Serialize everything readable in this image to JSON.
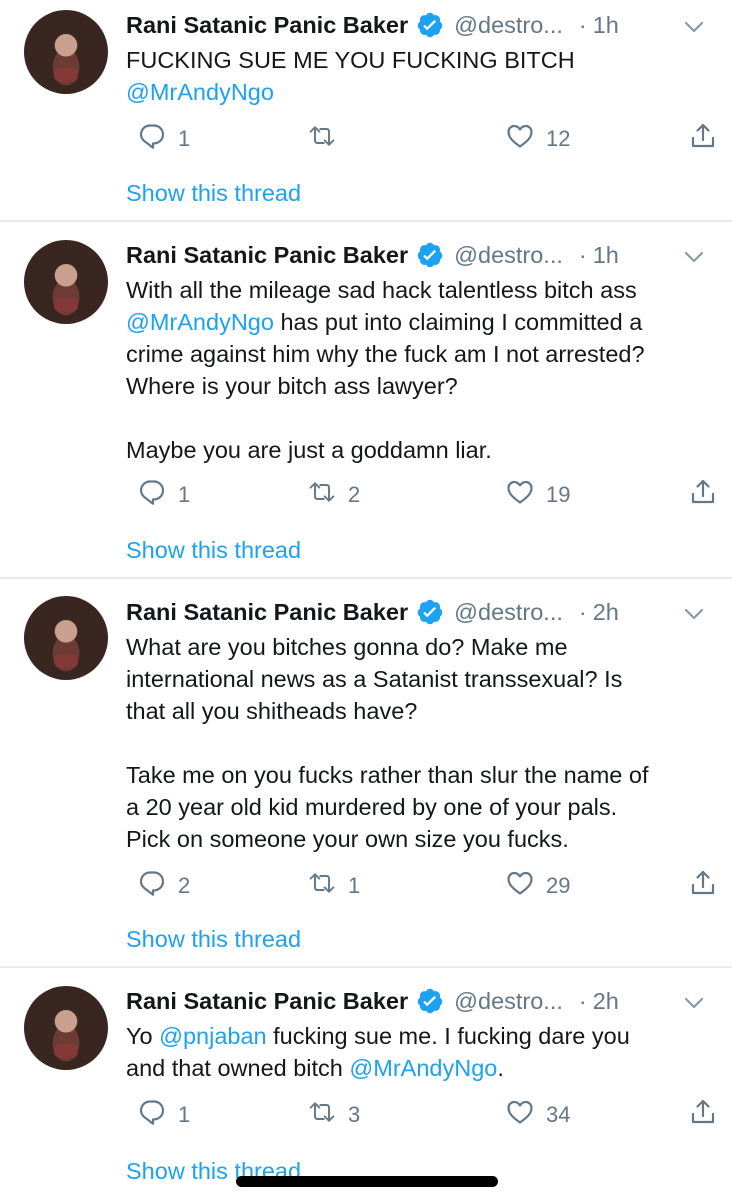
{
  "colors": {
    "accent": "#1da1f2",
    "muted": "#657786",
    "text": "#14171a",
    "divider": "#e6ecf0"
  },
  "icons": [
    "avatar",
    "verified-badge-icon",
    "chevron-down-icon",
    "reply-icon",
    "retweet-icon",
    "like-icon",
    "share-icon"
  ],
  "tweets": [
    {
      "name": "Rani Satanic Panic Baker",
      "handle": "@destro...",
      "dot": "·",
      "time": "1h",
      "body": [
        {
          "t": "FUCKING SUE ME YOU FUCKING BITCH\n"
        },
        {
          "t": "@MrAndyNgo",
          "m": true
        }
      ],
      "replies": "1",
      "retweets": "",
      "likes": "12",
      "thread_label": "Show this thread"
    },
    {
      "name": "Rani Satanic Panic Baker",
      "handle": "@destro...",
      "dot": "·",
      "time": "1h",
      "body": [
        {
          "t": "With all the mileage sad hack talentless bitch ass\n"
        },
        {
          "t": "@MrAndyNgo",
          "m": true
        },
        {
          "t": " has put into claiming I committed a\ncrime against him why the fuck am I not arrested?\nWhere is your bitch ass lawyer?\n\nMaybe you are just a goddamn liar."
        }
      ],
      "replies": "1",
      "retweets": "2",
      "likes": "19",
      "thread_label": "Show this thread"
    },
    {
      "name": "Rani Satanic Panic Baker",
      "handle": "@destro...",
      "dot": "·",
      "time": "2h",
      "body": [
        {
          "t": "What are you bitches gonna do? Make me\ninternational news as a Satanist transsexual? Is\nthat all you shitheads have?\n\nTake me on you fucks rather than slur the name of\na 20 year old kid murdered by one of your pals.\nPick on someone your own size you fucks."
        }
      ],
      "replies": "2",
      "retweets": "1",
      "likes": "29",
      "thread_label": "Show this thread"
    },
    {
      "name": "Rani Satanic Panic Baker",
      "handle": "@destro...",
      "dot": "·",
      "time": "2h",
      "body": [
        {
          "t": "Yo "
        },
        {
          "t": "@pnjaban",
          "m": true
        },
        {
          "t": " fucking sue me. I fucking dare you\nand that owned bitch "
        },
        {
          "t": "@MrAndyNgo",
          "m": true
        },
        {
          "t": "."
        }
      ],
      "replies": "1",
      "retweets": "3",
      "likes": "34",
      "thread_label": "Show this thread"
    }
  ]
}
